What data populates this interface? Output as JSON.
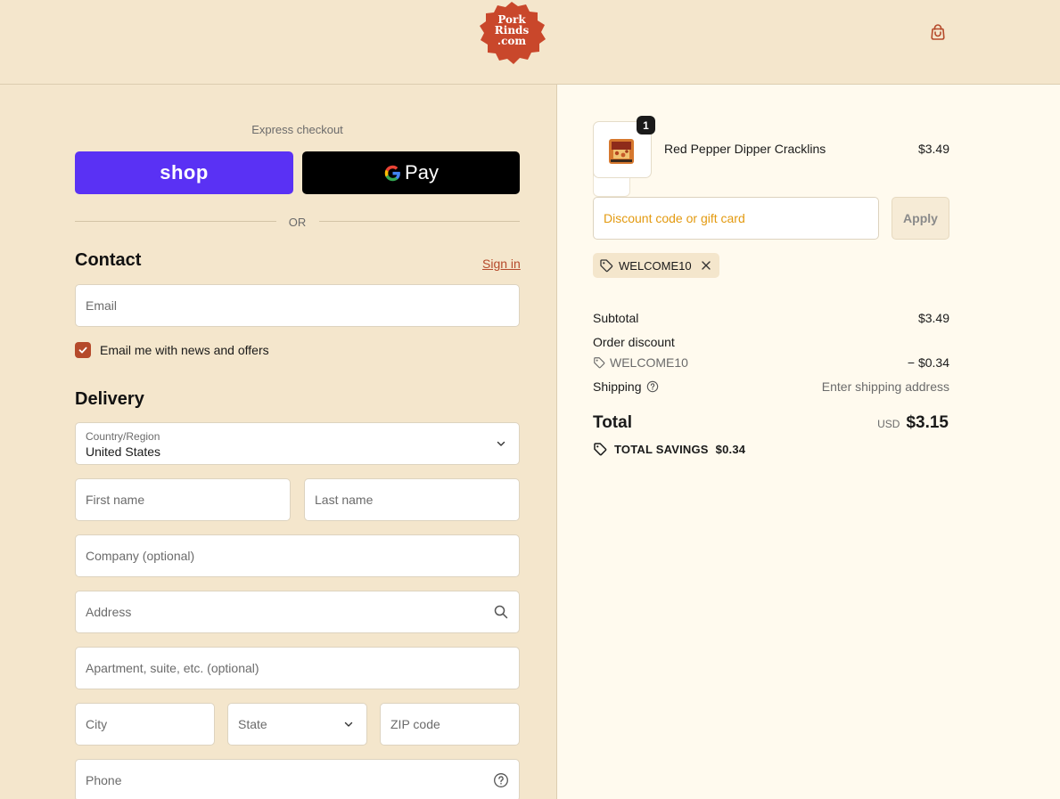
{
  "header": {
    "logo": {
      "line1": "Pork",
      "line2": "Rinds",
      "line3": ".com"
    },
    "cart_icon": "shopping-bag-icon"
  },
  "checkout": {
    "express_label": "Express checkout",
    "shop_pay_label": "shop",
    "gpay_label": "Pay",
    "or_label": "OR"
  },
  "contact": {
    "title": "Contact",
    "sign_in": "Sign in",
    "email_placeholder": "Email",
    "newsletter_label": "Email me with news and offers",
    "newsletter_checked": true
  },
  "delivery": {
    "title": "Delivery",
    "country_label": "Country/Region",
    "country_value": "United States",
    "first_name": "First name",
    "last_name": "Last name",
    "company": "Company (optional)",
    "address": "Address",
    "apartment": "Apartment, suite, etc. (optional)",
    "city": "City",
    "state": "State",
    "zip": "ZIP code",
    "phone": "Phone"
  },
  "order": {
    "item": {
      "name": "Red Pepper Dipper Cracklins",
      "price": "$3.49",
      "quantity": "1"
    },
    "discount_placeholder": "Discount code or gift card",
    "apply_label": "Apply",
    "applied_code": "WELCOME10",
    "subtotal_label": "Subtotal",
    "subtotal_value": "$3.49",
    "order_discount_label": "Order discount",
    "discount_code": "WELCOME10",
    "discount_value": "− $0.34",
    "shipping_label": "Shipping",
    "shipping_value": "Enter shipping address",
    "total_label": "Total",
    "total_currency": "USD",
    "total_value": "$3.15",
    "savings_label": "TOTAL SAVINGS",
    "savings_value": "$0.34"
  },
  "colors": {
    "background": "#f4e6cc",
    "summary_background": "#fffaee",
    "brand": "#c9472b",
    "shop_pay": "#5a31f4",
    "link": "#b54a2b",
    "placeholder_accent": "#e39a10"
  }
}
